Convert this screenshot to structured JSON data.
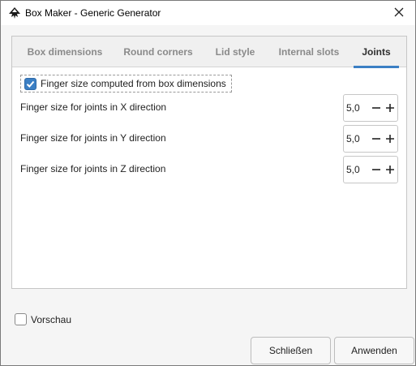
{
  "window": {
    "title": "Box Maker - Generic Generator",
    "app_icon": "inkscape-icon",
    "close_icon": "close-icon"
  },
  "tabs": [
    {
      "label": "Box dimensions",
      "active": false
    },
    {
      "label": "Round corners",
      "active": false
    },
    {
      "label": "Lid style",
      "active": false
    },
    {
      "label": "Internal slots",
      "active": false
    },
    {
      "label": "Joints",
      "active": true
    }
  ],
  "joints": {
    "auto_finger_label": "Finger size computed from box dimensions",
    "auto_finger_checked": true,
    "params": [
      {
        "label": "Finger size for joints in X direction",
        "value": "5,0"
      },
      {
        "label": "Finger size for joints in Y direction",
        "value": "5,0"
      },
      {
        "label": "Finger size for joints in Z direction",
        "value": "5,0"
      }
    ]
  },
  "footer": {
    "preview_label": "Vorschau",
    "preview_checked": false,
    "close_label": "Schließen",
    "apply_label": "Anwenden"
  },
  "colors": {
    "accent": "#3b7fc4",
    "tab_inactive": "#8a8a8a",
    "tab_active": "#2e2e2e"
  }
}
